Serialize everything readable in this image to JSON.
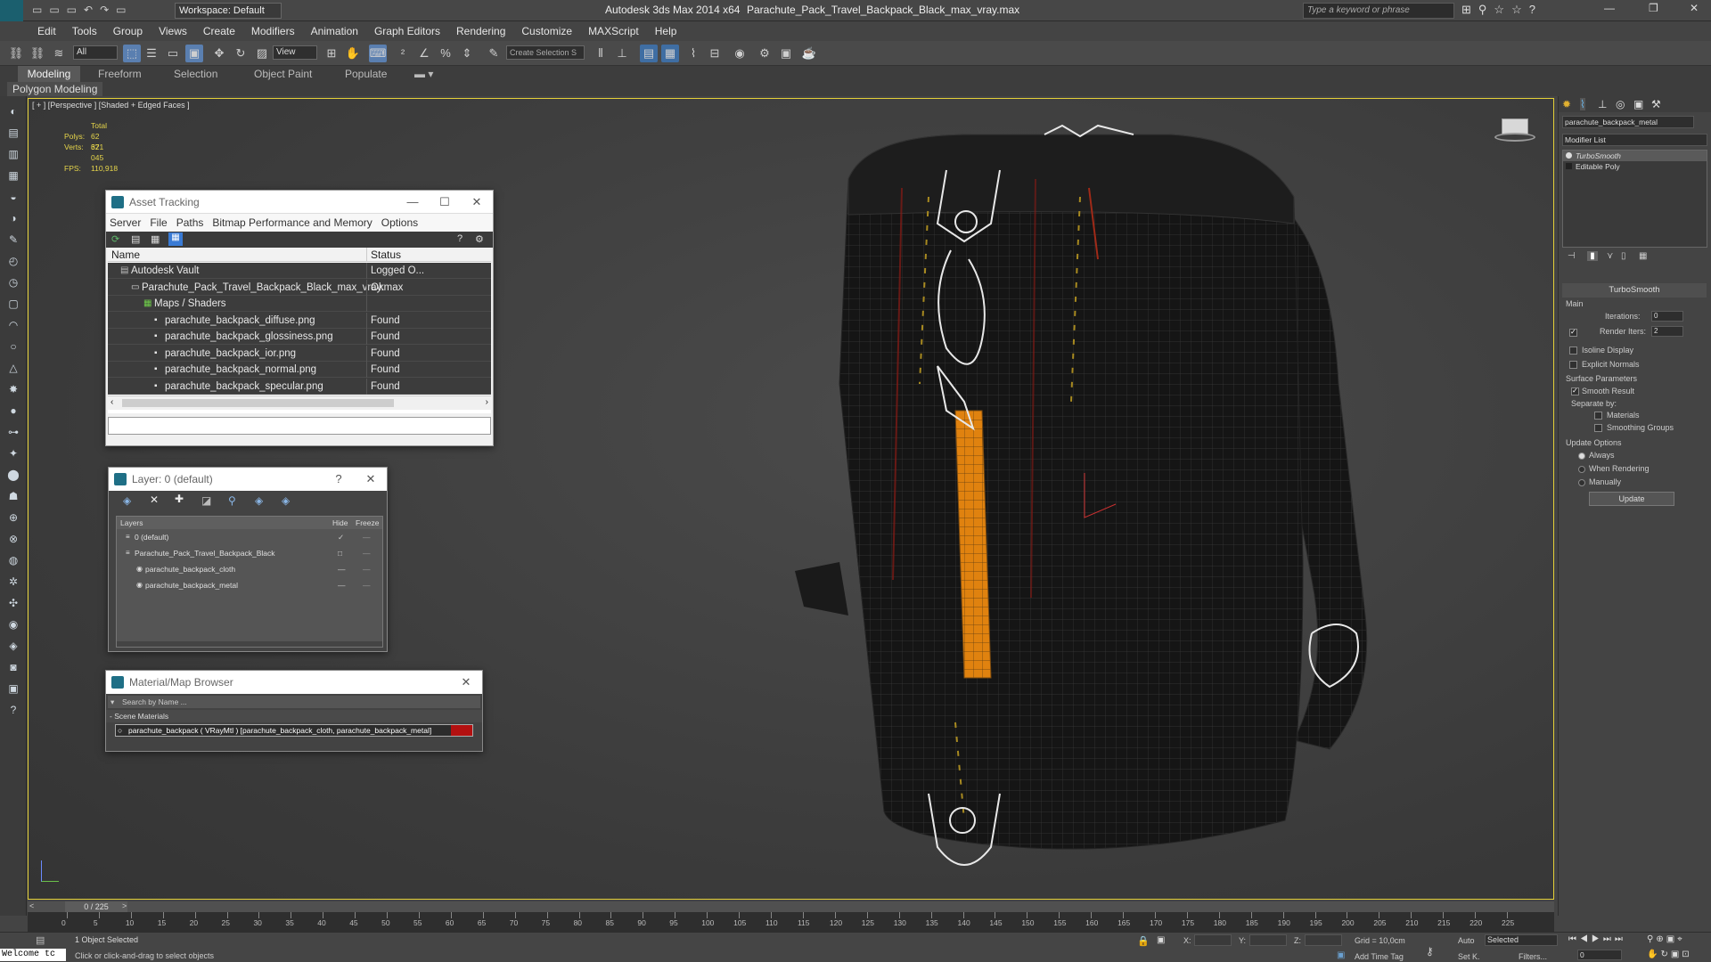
{
  "titlebar": {
    "workspace": "Workspace: Default",
    "title": "Autodesk 3ds Max  2014 x64",
    "filename": "Parachute_Pack_Travel_Backpack_Black_max_vray.max",
    "search_placeholder": "Type a keyword or phrase"
  },
  "menu": [
    "Edit",
    "Tools",
    "Group",
    "Views",
    "Create",
    "Modifiers",
    "Animation",
    "Graph Editors",
    "Rendering",
    "Customize",
    "MAXScript",
    "Help"
  ],
  "toolbar": {
    "selection_filter": "All",
    "ref_coord": "View",
    "named_selection": "Create Selection S"
  },
  "ribbon": {
    "tabs": [
      "Modeling",
      "Freeform",
      "Selection",
      "Object Paint",
      "Populate"
    ],
    "sub": "Polygon Modeling"
  },
  "viewport": {
    "label": "[ + ] [Perspective ] [Shaded + Edged Faces ]",
    "stats": {
      "total": "Total",
      "polys_label": "Polys:",
      "polys": "62 671",
      "verts_label": "Verts:",
      "verts": "32 045",
      "fps_label": "FPS:",
      "fps": "110,918"
    }
  },
  "asset_tracking": {
    "title": "Asset Tracking",
    "menu": [
      "Server",
      "File",
      "Paths",
      "Bitmap Performance and Memory",
      "Options"
    ],
    "col_name": "Name",
    "col_status": "Status",
    "rows": [
      {
        "name": "Autodesk Vault",
        "status": "Logged O..."
      },
      {
        "name": "Parachute_Pack_Travel_Backpack_Black_max_vray.max",
        "status": "Ok"
      },
      {
        "name": "Maps / Shaders",
        "status": ""
      },
      {
        "name": "parachute_backpack_diffuse.png",
        "status": "Found"
      },
      {
        "name": "parachute_backpack_glossiness.png",
        "status": "Found"
      },
      {
        "name": "parachute_backpack_ior.png",
        "status": "Found"
      },
      {
        "name": "parachute_backpack_normal.png",
        "status": "Found"
      },
      {
        "name": "parachute_backpack_specular.png",
        "status": "Found"
      }
    ]
  },
  "layer_window": {
    "title": "Layer: 0 (default)",
    "col_layers": "Layers",
    "col_hide": "Hide",
    "col_freeze": "Freeze",
    "rows": [
      "0 (default)",
      "Parachute_Pack_Travel_Backpack_Black",
      "parachute_backpack_cloth",
      "parachute_backpack_metal"
    ]
  },
  "material_browser": {
    "title": "Material/Map Browser",
    "search": "Search by Name ...",
    "section": "- Scene Materials",
    "item": "parachute_backpack  ( VRayMtl )  [parachute_backpack_cloth, parachute_backpack_metal]"
  },
  "command_panel": {
    "object_name": "parachute_backpack_metal",
    "modifier_list": "Modifier List",
    "stack": [
      "TurboSmooth",
      "Editable Poly"
    ],
    "turbosmooth": {
      "title": "TurboSmooth",
      "main": "Main",
      "iterations_label": "Iterations:",
      "iterations": "0",
      "render_iters_label": "Render Iters:",
      "render_iters": "2",
      "isoline": "Isoline Display",
      "explicit": "Explicit Normals",
      "surface": "Surface Parameters",
      "smooth_result": "Smooth Result",
      "separate": "Separate by:",
      "materials": "Materials",
      "smoothing_groups": "Smoothing Groups",
      "update_options": "Update Options",
      "always": "Always",
      "when_rendering": "When Rendering",
      "manually": "Manually",
      "update_btn": "Update"
    }
  },
  "timeline": {
    "frame": "0 / 225",
    "ticks": [
      "0",
      "5",
      "10",
      "15",
      "20",
      "25",
      "30",
      "35",
      "40",
      "45",
      "50",
      "55",
      "60",
      "65",
      "70",
      "75",
      "80",
      "85",
      "90",
      "95",
      "100",
      "105",
      "110",
      "115",
      "120",
      "125",
      "130",
      "135",
      "140",
      "145",
      "150",
      "155",
      "160",
      "165",
      "170",
      "175",
      "180",
      "185",
      "190",
      "195",
      "200",
      "205",
      "210",
      "215",
      "220",
      "225"
    ]
  },
  "status": {
    "welcome": "Welcome tc",
    "selected": "1 Object Selected",
    "prompt": "Click or click-and-drag to select objects",
    "x_label": "X:",
    "y_label": "Y:",
    "z_label": "Z:",
    "grid": "Grid = 10,0cm",
    "add_time_tag": "Add Time Tag",
    "auto": "Auto",
    "setk": "Set K.",
    "selected_dd": "Selected",
    "filters": "Filters...",
    "frame_field": "0"
  }
}
